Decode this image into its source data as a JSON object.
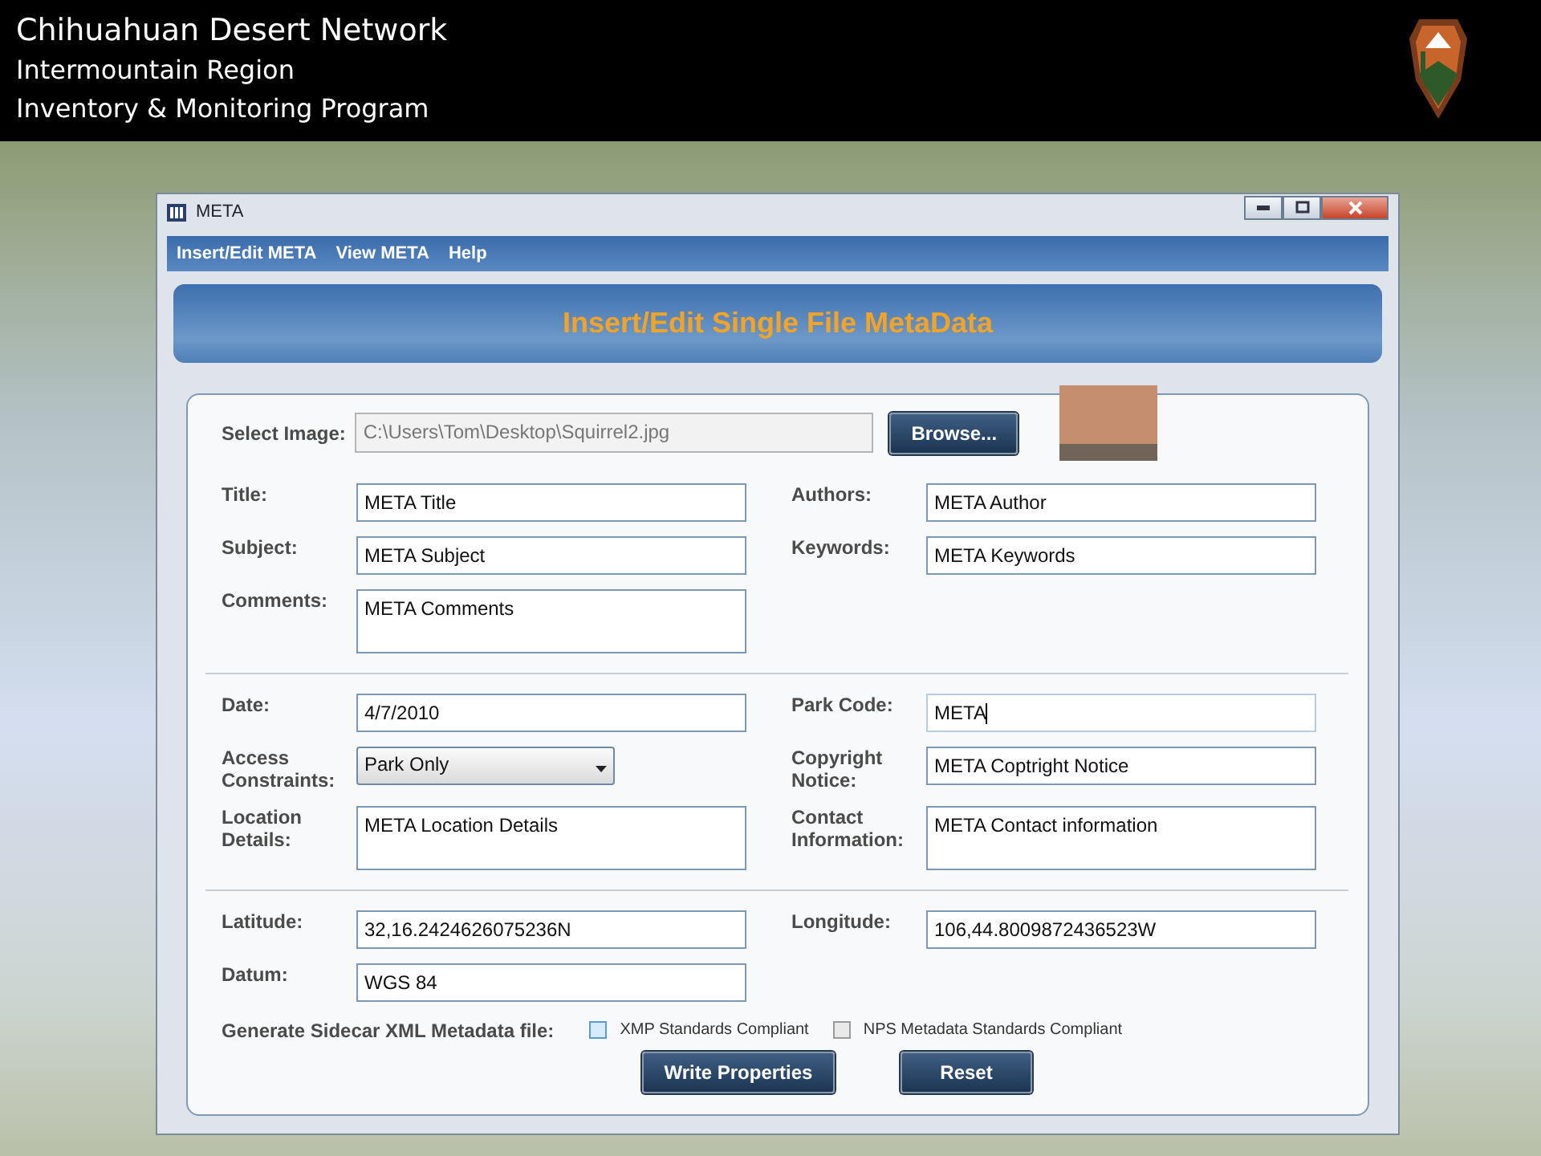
{
  "header": {
    "title": "Chihuahuan Desert Network",
    "lines": [
      "Intermountain Region",
      "Inventory & Monitoring Program"
    ]
  },
  "window": {
    "title": "META",
    "menu": [
      "Insert/Edit META",
      "View META",
      "Help"
    ],
    "banner": "Insert/Edit Single File MetaData"
  },
  "select_image": {
    "label": "Select Image:",
    "value": "C:\\Users\\Tom\\Desktop\\Squirrel2.jpg",
    "disabled": true,
    "browse_button": "Browse..."
  },
  "sections": [
    [
      {
        "left": {
          "label": "Title:",
          "value": "META Title",
          "kind": "text",
          "focused": false
        },
        "right": {
          "label": "Authors:",
          "value": "META Author",
          "kind": "text",
          "focused": false
        }
      },
      {
        "left": {
          "label": "Subject:",
          "value": "META Subject",
          "kind": "text",
          "focused": false
        },
        "right": {
          "label": "Keywords:",
          "value": "META Keywords",
          "kind": "text",
          "focused": false
        }
      },
      {
        "left": {
          "label": "Comments:",
          "value": "META Comments",
          "kind": "textarea",
          "focused": false
        }
      }
    ],
    [
      {
        "left": {
          "label": "Date:",
          "value": "4/7/2010",
          "kind": "text",
          "focused": false
        },
        "right": {
          "label": "Park Code:",
          "value": "META",
          "kind": "text",
          "focused": true
        }
      },
      {
        "left": {
          "label": "Access Constraints:",
          "value": "Park Only",
          "kind": "dropdown",
          "focused": false
        },
        "right": {
          "label": "Copyright Notice:",
          "value": "META Coptright Notice",
          "kind": "text",
          "focused": false
        }
      },
      {
        "left": {
          "label": "Location Details:",
          "value": "META Location Details",
          "kind": "textarea",
          "focused": false
        },
        "right": {
          "label": "Contact Information:",
          "value": "META Contact information",
          "kind": "textarea",
          "focused": false
        }
      }
    ],
    [
      {
        "left": {
          "label": "Latitude:",
          "value": "32,16.2424626075236N",
          "kind": "text",
          "focused": false
        },
        "right": {
          "label": "Longitude:",
          "value": "106,44.8009872436523W",
          "kind": "text",
          "focused": false
        }
      },
      {
        "left": {
          "label": "Datum:",
          "value": "WGS 84",
          "kind": "text",
          "focused": false
        }
      }
    ]
  ],
  "sidecar": {
    "label": "Generate Sidecar XML Metadata file:",
    "options": [
      {
        "label": "XMP Standards Compliant",
        "checked": false,
        "hovered": true
      },
      {
        "label": "NPS Metadata Standards Compliant",
        "checked": false,
        "hovered": false
      }
    ]
  },
  "buttons": [
    "Write Properties",
    "Reset"
  ]
}
